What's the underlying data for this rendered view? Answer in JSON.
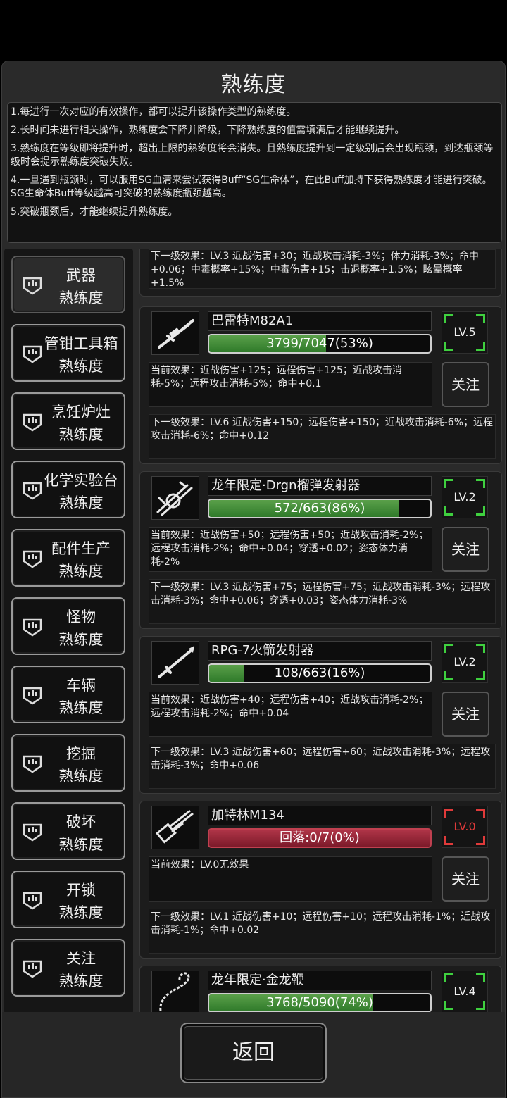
{
  "title": "熟练度",
  "info_lines": [
    "1.每进行一次对应的有效操作，都可以提升该操作类型的熟练度。",
    "2.长时间未进行相关操作，熟练度会下降并降级，下降熟练度的值需填满后才能继续提升。",
    "3.熟练度在等级即将提升时，超出上限的熟练度将会消失。且熟练度提升到一定级别后会出现瓶颈，到达瓶颈等级时会提示熟练度突破失败。",
    "4.一旦遇到瓶颈时，可以服用SG血清来尝试获得Buff“SG生命体”，在此Buff加持下获得熟练度才能进行突破。SG生命体Buff等级越高可突破的熟练度瓶颈越高。",
    "5.突破瓶颈后，才能继续提升熟练度。"
  ],
  "categories": [
    {
      "name": "武器",
      "sub": "熟练度",
      "active": true
    },
    {
      "name": "管钳工具箱",
      "sub": "熟练度"
    },
    {
      "name": "烹饪炉灶",
      "sub": "熟练度"
    },
    {
      "name": "化学实验台",
      "sub": "熟练度"
    },
    {
      "name": "配件生产",
      "sub": "熟练度"
    },
    {
      "name": "怪物",
      "sub": "熟练度"
    },
    {
      "name": "车辆",
      "sub": "熟练度"
    },
    {
      "name": "挖掘",
      "sub": "熟练度"
    },
    {
      "name": "破坏",
      "sub": "熟练度"
    },
    {
      "name": "开锁",
      "sub": "熟练度"
    },
    {
      "name": "关注",
      "sub": "熟练度"
    }
  ],
  "top_next": "下一级效果：LV.3 近战伤害+30；近战攻击消耗-3%；体力消耗-3%；命中+0.06；中毒概率+15%；中毒伤害+15；击退概率+1.5%；眩晕概率+1.5%",
  "follow_label": "关注",
  "back_label": "返回",
  "weapons": [
    {
      "name": "巴雷特M82A1",
      "progress_text": "3799/7047(53%)",
      "progress": 0.53,
      "level": "LV.5",
      "current": "当前效果：近战伤害+125；远程伤害+125；近战攻击消耗-5%；远程攻击消耗-5%；命中+0.1",
      "next": "下一级效果：LV.6 近战伤害+150；远程伤害+150；近战攻击消耗-6%；远程攻击消耗-6%；命中+0.12",
      "icon": "sniper-rifle"
    },
    {
      "name": "龙年限定·Drgn榴弹发射器",
      "progress_text": "572/663(86%)",
      "progress": 0.86,
      "level": "LV.2",
      "current": "当前效果：近战伤害+50；远程伤害+50；近战攻击消耗-2%；远程攻击消耗-2%；命中+0.04；穿透+0.02；姿态体力消耗-2%",
      "next": "下一级效果：LV.3 近战伤害+75；远程伤害+75；近战攻击消耗-3%；远程攻击消耗-3%；命中+0.06；穿透+0.03；姿态体力消耗-3%",
      "icon": "grenade-launcher"
    },
    {
      "name": "RPG-7火箭发射器",
      "progress_text": "108/663(16%)",
      "progress": 0.16,
      "level": "LV.2",
      "current": "当前效果：近战伤害+40；远程伤害+40；近战攻击消耗-2%；远程攻击消耗-2%；命中+0.04",
      "next": "下一级效果：LV.3 近战伤害+60；远程伤害+60；近战攻击消耗-3%；远程攻击消耗-3%；命中+0.06",
      "icon": "rocket-launcher"
    },
    {
      "name": "加特林M134",
      "progress_text": "回落:0/7(0%)",
      "progress": 1.0,
      "level": "LV.0",
      "decline": true,
      "current": "当前效果：LV.0无效果",
      "next": "下一级效果：LV.1 近战伤害+10；远程伤害+10；远程攻击消耗-1%；近战攻击消耗-1%；命中+0.02",
      "icon": "gatling"
    },
    {
      "name": "龙年限定·金龙鞭",
      "progress_text": "3768/5090(74%)",
      "progress": 0.74,
      "level": "LV.4",
      "current": "",
      "next": "",
      "icon": "whip"
    }
  ]
}
